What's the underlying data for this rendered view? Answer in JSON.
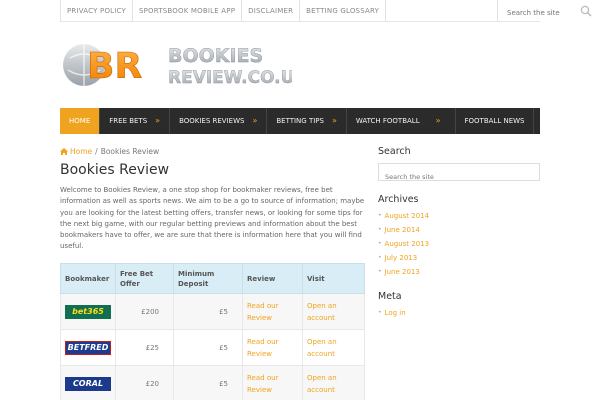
{
  "top_links": [
    "PRIVACY POLICY",
    "SPORTSBOOK MOBILE APP",
    "DISCLAIMER",
    "BETTING GLOSSARY"
  ],
  "top_search_placeholder": "Search the site",
  "logo": {
    "letters": "BR",
    "line1": "BOOKIES",
    "line2": "REVIEW.CO.UK"
  },
  "nav": [
    {
      "label": "HOME",
      "arrow": ""
    },
    {
      "label": "FREE BETS",
      "arrow": "»"
    },
    {
      "label": "BOOKIES REVIEWS",
      "arrow": "»"
    },
    {
      "label": "BETTING TIPS",
      "arrow": "»"
    },
    {
      "label": "WATCH FOOTBALL",
      "arrow": "»"
    },
    {
      "label": "FOOTBALL NEWS",
      "arrow": ""
    }
  ],
  "breadcrumb": {
    "home": "Home",
    "sep": "/",
    "current": "Bookies Review"
  },
  "page_title": "Bookies Review",
  "intro": "Welcome to Bookies Review, a one stop shop for bookmaker reviews, free bet information as well as sports news. We aim to be a go to source of information; maybe you are looking for the latest betting offers, transfer news, or looking for some tips for the next big game, with our regular betting previews and information about the best bookmakers have to offer, we are sure that there is information here that you will find useful.",
  "table": {
    "headers": [
      "Bookmaker",
      "Free Bet Offer",
      "Minimum Deposit",
      "Review",
      "Visit"
    ],
    "rows": [
      {
        "logo": "bet365",
        "offer": "£200",
        "deposit": "£5",
        "review": "Read our Review",
        "visit": "Open an account"
      },
      {
        "logo": "BETFRED",
        "offer": "£25",
        "deposit": "£5",
        "review": "Read our Review",
        "visit": "Open an account"
      },
      {
        "logo": "CORAL",
        "offer": "£20",
        "deposit": "£5",
        "review": "Read our Review",
        "visit": "Open an account"
      }
    ]
  },
  "sidebar": {
    "search_title": "Search",
    "search_placeholder": "Search the site",
    "archives_title": "Archives",
    "archives": [
      "August 2014",
      "June 2014",
      "August 2013",
      "July 2013",
      "June 2013"
    ],
    "meta_title": "Meta",
    "meta": [
      "Log in"
    ]
  },
  "colors": {
    "accent": "#f0a31f",
    "nav_bg": "#2b2b2b",
    "table_header": "#d9edf7"
  }
}
